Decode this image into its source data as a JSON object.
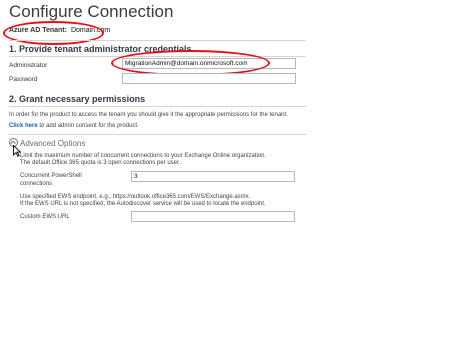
{
  "page": {
    "title": "Configure Connection"
  },
  "tenant": {
    "label": "Azure AD Tenant:",
    "value": "Domain.com"
  },
  "section1": {
    "title": "1. Provide tenant administrator credentials",
    "administrator_label": "Administrator",
    "administrator_value": "MigrationAdmin@domain.onmicrosoft.com",
    "password_label": "Password",
    "password_value": ""
  },
  "section2": {
    "title": "2. Grant necessary permissions",
    "description": "In order for the product to access the tenant you should give it the appropriate permissions for the tenant.",
    "click_here": "Click here",
    "link_suffix": " to add admin consent for the product."
  },
  "advanced": {
    "title": "Advanced Options",
    "limit_line1": "Limit the maximum number of concurrent connections to your Exchange Online organization.",
    "limit_line2": "The default Office 365 quota is 3 open connections per user.",
    "ps_label_line1": "Concurrent PowerShell",
    "ps_label_line2": "connections",
    "ps_value": "3",
    "ews_line1": "Use specified EWS endpoint, e.g., https://outlook.office365.com/EWS/Exchange.asmx.",
    "ews_line2": "If the EWS URL is not specified, the Autodiscover service will be used to locate the endpoint.",
    "ews_label": "Custom EWS URL",
    "ews_value": ""
  },
  "colors": {
    "highlight": "#e0121b",
    "link": "#1a5ea8",
    "section_title": "#2f3a46"
  }
}
